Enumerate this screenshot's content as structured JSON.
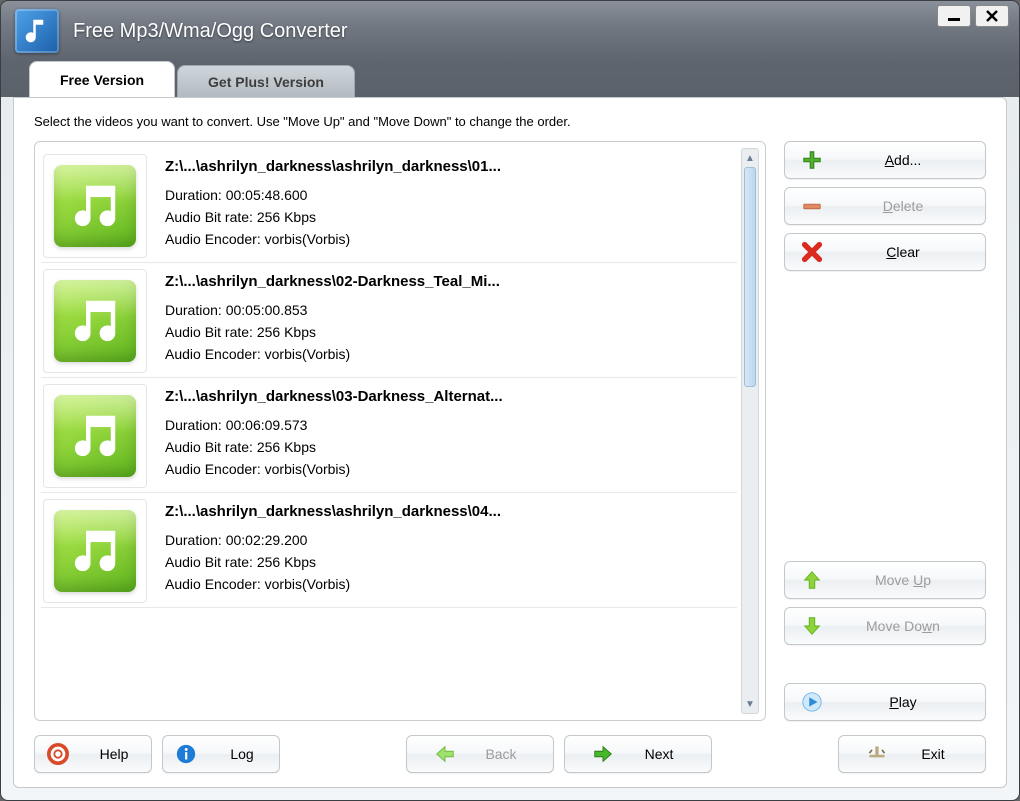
{
  "title": "Free Mp3/Wma/Ogg Converter",
  "window_controls": {
    "minimize": "—",
    "close": "✕"
  },
  "tabs": [
    {
      "label": "Free Version",
      "active": true
    },
    {
      "label": "Get Plus! Version",
      "active": false
    }
  ],
  "instruction": "Select the videos you want to convert. Use \"Move Up\" and \"Move Down\" to change the order.",
  "items": [
    {
      "path": "Z:\\...\\ashrilyn_darkness\\ashrilyn_darkness\\01...",
      "duration": "Duration: 00:05:48.600",
      "bitrate": "Audio Bit rate: 256 Kbps",
      "encoder": "Audio Encoder: vorbis(Vorbis)"
    },
    {
      "path": "Z:\\...\\ashrilyn_darkness\\02-Darkness_Teal_Mi...",
      "duration": "Duration: 00:05:00.853",
      "bitrate": "Audio Bit rate: 256 Kbps",
      "encoder": "Audio Encoder: vorbis(Vorbis)"
    },
    {
      "path": "Z:\\...\\ashrilyn_darkness\\03-Darkness_Alternat...",
      "duration": "Duration: 00:06:09.573",
      "bitrate": "Audio Bit rate: 256 Kbps",
      "encoder": "Audio Encoder: vorbis(Vorbis)"
    },
    {
      "path": "Z:\\...\\ashrilyn_darkness\\ashrilyn_darkness\\04...",
      "duration": "Duration: 00:02:29.200",
      "bitrate": "Audio Bit rate: 256 Kbps",
      "encoder": "Audio Encoder: vorbis(Vorbis)"
    }
  ],
  "buttons": {
    "add": "Add...",
    "delete": "Delete",
    "clear": "Clear",
    "move_up": "Move Up",
    "move_down": "Move Down",
    "play": "Play",
    "help": "Help",
    "log": "Log",
    "back": "Back",
    "next": "Next",
    "exit": "Exit"
  }
}
